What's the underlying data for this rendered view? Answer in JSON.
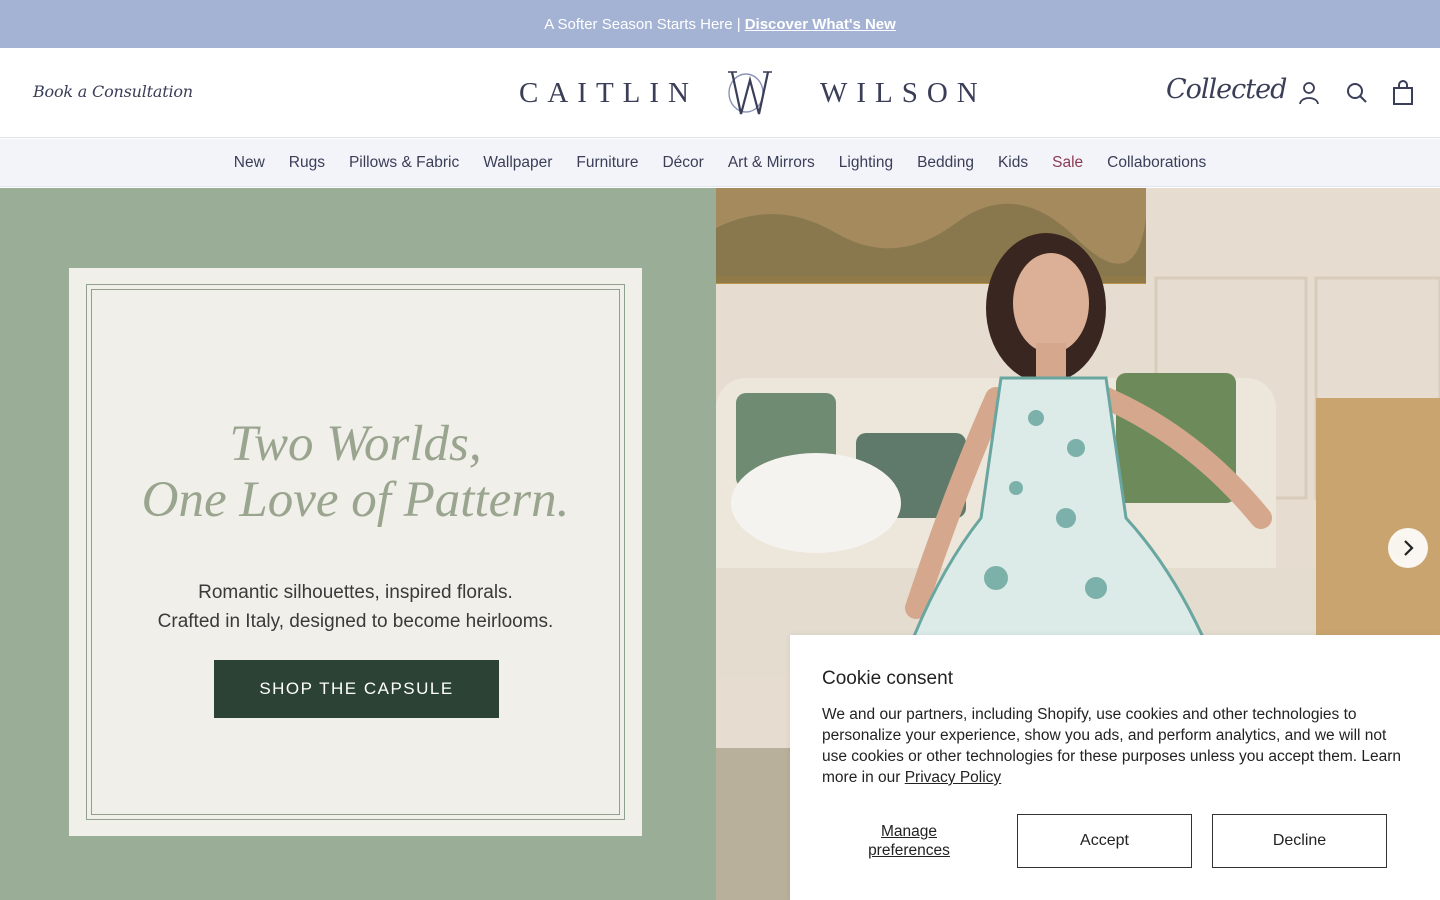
{
  "announcement": {
    "text": "A Softer Season Starts Here |",
    "link": "Discover What's New"
  },
  "header": {
    "consultation": "Book a Consultation",
    "logo_left": "CAITLIN",
    "logo_right": "WILSON",
    "collected": "Collected",
    "icons": [
      "account-icon",
      "search-icon",
      "cart-icon"
    ]
  },
  "nav": {
    "items": [
      "New",
      "Rugs",
      "Pillows & Fabric",
      "Wallpaper",
      "Furniture",
      "Décor",
      "Art & Mirrors",
      "Lighting",
      "Bedding",
      "Kids",
      "Sale",
      "Collaborations"
    ]
  },
  "hero": {
    "headline_1": "Two Worlds,",
    "headline_2": "One Love of Pattern.",
    "sub_1": "Romantic silhouettes, inspired florals.",
    "sub_2": "Crafted in Italy, designed to become heirlooms.",
    "cta": "SHOP THE CAPSULE",
    "next_icon": "chevron-right-icon"
  },
  "cookie": {
    "title": "Cookie consent",
    "body": "We and our partners, including Shopify, use cookies and other technologies to personalize your experience, show you ads, and perform analytics, and we will not use cookies or other technologies for these purposes unless you accept them. Learn more in our",
    "policy_link": "Privacy Policy",
    "manage": "Manage preferences",
    "accept": "Accept",
    "decline": "Decline"
  },
  "colors": {
    "announce_bg": "#a4b3d4",
    "hero_green": "#9aae97",
    "cta_bg": "#2b4234",
    "sale": "#8c3a52"
  }
}
